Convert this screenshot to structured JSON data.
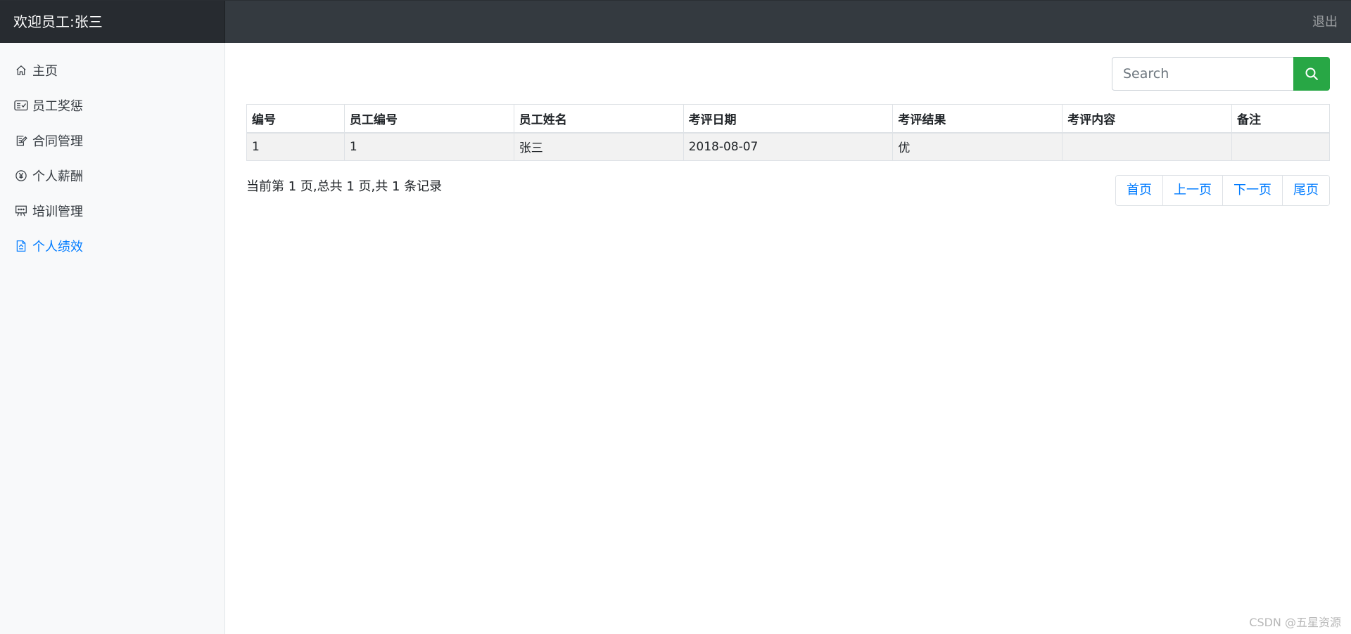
{
  "header": {
    "brand": "欢迎员工:张三",
    "logout_label": "退出"
  },
  "sidebar": {
    "items": [
      {
        "label": "主页",
        "icon": "home-icon"
      },
      {
        "label": "员工奖惩",
        "icon": "card-check-icon"
      },
      {
        "label": "合同管理",
        "icon": "document-edit-icon"
      },
      {
        "label": "个人薪酬",
        "icon": "yen-circle-icon"
      },
      {
        "label": "培训管理",
        "icon": "presentation-icon"
      },
      {
        "label": "个人绩效",
        "icon": "performance-document-icon",
        "active": true
      }
    ],
    "active_color": "#007bff"
  },
  "search": {
    "placeholder": "Search",
    "value": "",
    "button_color": "#28a745",
    "button_icon": "search-icon"
  },
  "table": {
    "columns": [
      "编号",
      "员工编号",
      "员工姓名",
      "考评日期",
      "考评结果",
      "考评内容",
      "备注"
    ],
    "rows": [
      [
        "1",
        "1",
        "张三",
        "2018-08-07",
        "优",
        "",
        ""
      ]
    ]
  },
  "pagination": {
    "info": "当前第 1 页,总共 1 页,共 1 条记录",
    "first": "首页",
    "prev": "上一页",
    "next": "下一页",
    "last": "尾页"
  },
  "watermark": "CSDN @五星资源"
}
